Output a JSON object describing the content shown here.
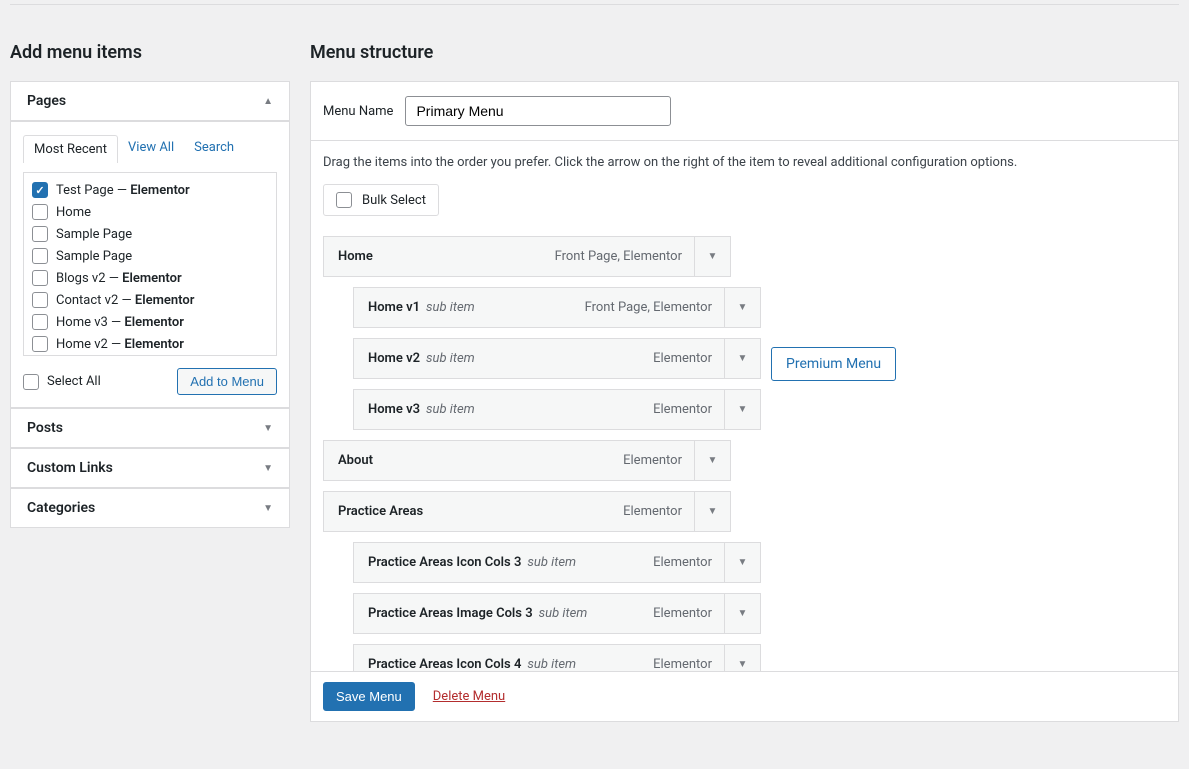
{
  "left": {
    "heading": "Add menu items",
    "pagesSection": {
      "title": "Pages",
      "tabs": [
        "Most Recent",
        "View All",
        "Search"
      ],
      "activeTab": 0,
      "items": [
        {
          "label": "Test Page",
          "suffix": " — ",
          "bold": "Elementor",
          "checked": true
        },
        {
          "label": "Home",
          "suffix": "",
          "bold": "",
          "checked": false
        },
        {
          "label": "Sample Page",
          "suffix": "",
          "bold": "",
          "checked": false
        },
        {
          "label": "Sample Page",
          "suffix": "",
          "bold": "",
          "checked": false
        },
        {
          "label": "Blogs v2",
          "suffix": " — ",
          "bold": "Elementor",
          "checked": false
        },
        {
          "label": "Contact v2",
          "suffix": " — ",
          "bold": "Elementor",
          "checked": false
        },
        {
          "label": "Home v3",
          "suffix": " — ",
          "bold": "Elementor",
          "checked": false
        },
        {
          "label": "Home v2",
          "suffix": " — ",
          "bold": "Elementor",
          "checked": false
        }
      ],
      "selectAll": "Select All",
      "addToMenu": "Add to Menu"
    },
    "sections": [
      "Posts",
      "Custom Links",
      "Categories"
    ]
  },
  "right": {
    "heading": "Menu structure",
    "menuNameLabel": "Menu Name",
    "menuNameValue": "Primary Menu",
    "instructions": "Drag the items into the order you prefer. Click the arrow on the right of the item to reveal additional configuration options.",
    "bulkSelect": "Bulk Select",
    "items": [
      {
        "title": "Home",
        "sub": "",
        "type": "Front Page, Elementor",
        "indent": 0
      },
      {
        "title": "Home v1",
        "sub": "sub item",
        "type": "Front Page, Elementor",
        "indent": 1
      },
      {
        "title": "Home v2",
        "sub": "sub item",
        "type": "Elementor",
        "indent": 1,
        "badge": "Premium Menu"
      },
      {
        "title": "Home v3",
        "sub": "sub item",
        "type": "Elementor",
        "indent": 1
      },
      {
        "title": "About",
        "sub": "",
        "type": "Elementor",
        "indent": 0
      },
      {
        "title": "Practice Areas",
        "sub": "",
        "type": "Elementor",
        "indent": 0
      },
      {
        "title": "Practice Areas Icon Cols 3",
        "sub": "sub item",
        "type": "Elementor",
        "indent": 1
      },
      {
        "title": "Practice Areas Image Cols 3",
        "sub": "sub item",
        "type": "Elementor",
        "indent": 1
      },
      {
        "title": "Practice Areas Icon Cols 4",
        "sub": "sub item",
        "type": "Elementor",
        "indent": 1
      }
    ],
    "saveMenu": "Save Menu",
    "deleteMenu": "Delete Menu"
  }
}
